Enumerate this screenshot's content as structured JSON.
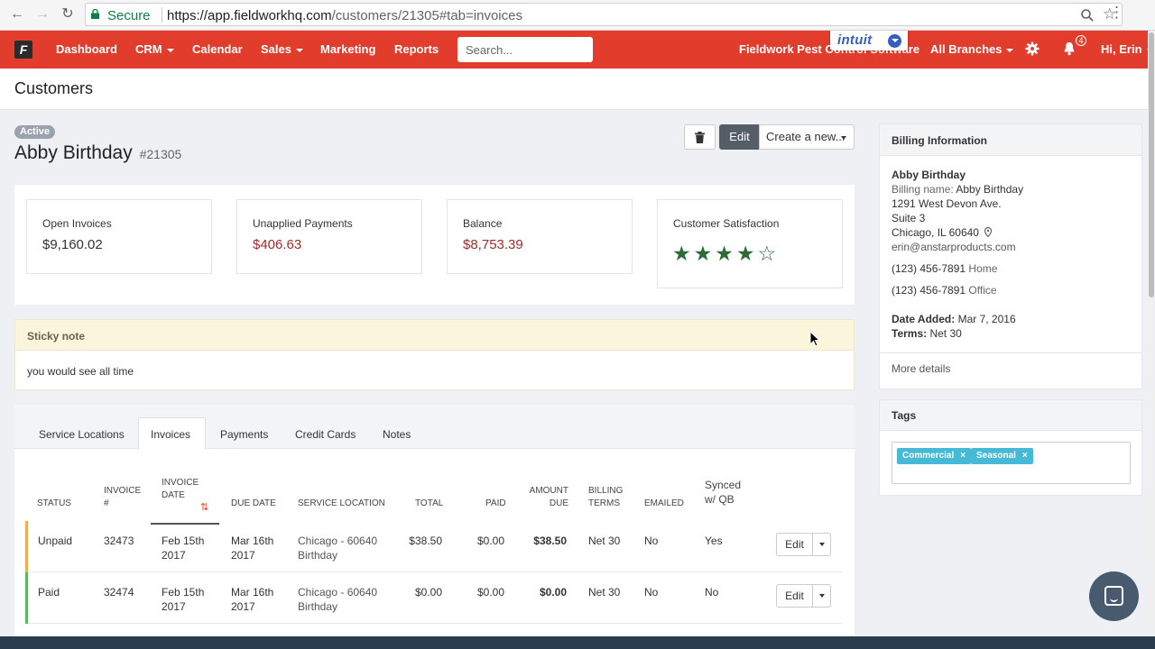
{
  "browser": {
    "secure_label": "Secure",
    "url_base": "https://app.fieldworkhq.com",
    "url_path": "/customers/21305#tab=invoices"
  },
  "nav": {
    "logo": "F",
    "items": [
      "Dashboard",
      "CRM",
      "Calendar",
      "Sales",
      "Marketing",
      "Reports"
    ],
    "search_placeholder": "Search...",
    "company": "Fieldwork Pest Control Software",
    "branches": "All Branches",
    "notification_count": "4",
    "user": "Hi, Erin",
    "intuit": "intuit"
  },
  "page": {
    "title": "Customers"
  },
  "customer": {
    "status": "Active",
    "name": "Abby Birthday",
    "number": "#21305"
  },
  "actions": {
    "edit": "Edit",
    "create": "Create a new..."
  },
  "summary": {
    "open_invoices": {
      "label": "Open Invoices",
      "value": "$9,160.02"
    },
    "unapplied_payments": {
      "label": "Unapplied Payments",
      "value": "$406.63"
    },
    "balance": {
      "label": "Balance",
      "value": "$8,753.39"
    },
    "satisfaction": {
      "label": "Customer Satisfaction",
      "rating": 4,
      "max": 5,
      "stars": "★★★★☆"
    }
  },
  "sticky": {
    "title": "Sticky note",
    "body": "you would see all time"
  },
  "tabs": [
    "Service Locations",
    "Invoices",
    "Payments",
    "Credit Cards",
    "Notes"
  ],
  "active_tab": "Invoices",
  "table": {
    "headers": {
      "status": "STATUS",
      "invoice_num": "INVOICE #",
      "invoice_date": "INVOICE DATE",
      "due_date": "DUE DATE",
      "service_location": "SERVICE LOCATION",
      "total": "TOTAL",
      "paid": "PAID",
      "amount_due": "AMOUNT DUE",
      "billing_terms": "BILLING TERMS",
      "emailed": "EMAILED",
      "synced": "Synced w/ QB"
    },
    "rows": [
      {
        "status": "Unpaid",
        "invoice": "32473",
        "invoice_date": "Feb 15th 2017",
        "due_date": "Mar 16th 2017",
        "location": "Chicago - 60640 Birthday",
        "total": "$38.50",
        "paid": "$0.00",
        "amount_due": "$38.50",
        "terms": "Net 30",
        "emailed": "No",
        "synced": "Yes",
        "edit": "Edit",
        "status_color": "#f0ad4e"
      },
      {
        "status": "Paid",
        "invoice": "32474",
        "invoice_date": "Feb 15th 2017",
        "due_date": "Mar 16th 2017",
        "location": "Chicago - 60640 Birthday",
        "total": "$0.00",
        "paid": "$0.00",
        "amount_due": "$0.00",
        "terms": "Net 30",
        "emailed": "No",
        "synced": "No",
        "edit": "Edit",
        "status_color": "#5cb85c"
      }
    ]
  },
  "billing": {
    "title": "Billing Information",
    "name": "Abby Birthday",
    "billing_name_label": "Billing name:",
    "billing_name": "Abby Birthday",
    "address1": "1291 West Devon Ave.",
    "address2": "Suite 3",
    "city_line": "Chicago, IL 60640",
    "email": "erin@anstarproducts.com",
    "phone1": "(123) 456-7891",
    "phone1_type": "Home",
    "phone2": "(123) 456-7891",
    "phone2_type": "Office",
    "date_added_label": "Date Added:",
    "date_added": "Mar 7, 2016",
    "terms_label": "Terms:",
    "terms": "Net 30",
    "more": "More details"
  },
  "tags": {
    "title": "Tags",
    "items": [
      "Commercial",
      "Seasonal"
    ]
  },
  "colors": {
    "brand": "#e23c2d",
    "money_negative": "#a52a2a",
    "tag": "#45b9d6",
    "star": "#2e6b34"
  }
}
